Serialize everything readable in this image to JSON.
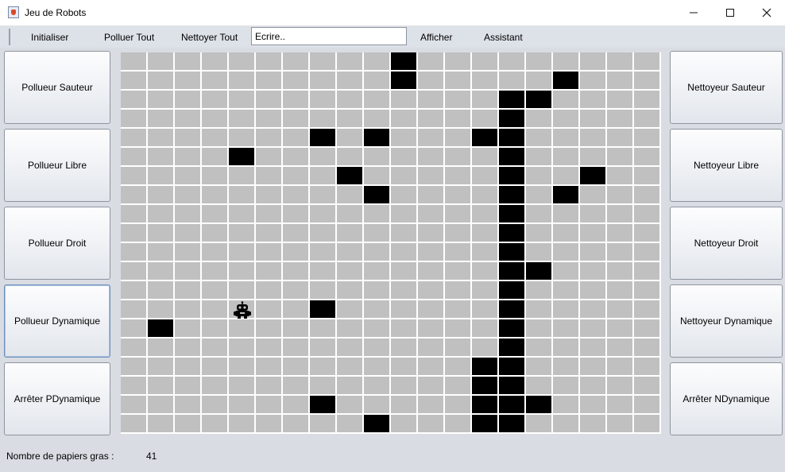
{
  "window": {
    "title": "Jeu de Robots",
    "icon": "java-app-icon",
    "controls": [
      "minimize-icon",
      "maximize-icon",
      "close-icon"
    ]
  },
  "menu": {
    "initialiser": "Initialiser",
    "polluer_tout": "Polluer Tout",
    "nettoyer_tout": "Nettoyer Tout",
    "input_value": "Ecrire..",
    "afficher": "Afficher",
    "assistant": "Assistant"
  },
  "left_buttons": [
    "Pollueur Sauteur",
    "Pollueur Libre",
    "Pollueur Droit",
    "Pollueur Dynamique",
    "Arrêter PDynamique"
  ],
  "right_buttons": [
    "Nettoyeur Sauteur",
    "Nettoyeur Libre",
    "Nettoyeur Droit",
    "Nettoyeur Dynamique",
    "Arrêter NDynamique"
  ],
  "grid": {
    "columns": 20,
    "rows": 20,
    "cell_color": "#c0c0c0",
    "paper_color": "#000000",
    "line_color": "#ffffff",
    "dirty_cells": [
      [
        0,
        10
      ],
      [
        1,
        10
      ],
      [
        1,
        16
      ],
      [
        2,
        14
      ],
      [
        2,
        15
      ],
      [
        3,
        14
      ],
      [
        4,
        7
      ],
      [
        4,
        9
      ],
      [
        4,
        13
      ],
      [
        4,
        14
      ],
      [
        5,
        4
      ],
      [
        5,
        14
      ],
      [
        6,
        8
      ],
      [
        6,
        14
      ],
      [
        6,
        17
      ],
      [
        7,
        9
      ],
      [
        7,
        14
      ],
      [
        7,
        16
      ],
      [
        8,
        14
      ],
      [
        9,
        14
      ],
      [
        10,
        14
      ],
      [
        11,
        14
      ],
      [
        11,
        15
      ],
      [
        12,
        14
      ],
      [
        13,
        7
      ],
      [
        13,
        14
      ],
      [
        14,
        1
      ],
      [
        14,
        14
      ],
      [
        15,
        14
      ],
      [
        16,
        13
      ],
      [
        16,
        14
      ],
      [
        17,
        13
      ],
      [
        17,
        14
      ],
      [
        18,
        7
      ],
      [
        18,
        13
      ],
      [
        18,
        14
      ],
      [
        18,
        15
      ],
      [
        19,
        9
      ],
      [
        19,
        13
      ],
      [
        19,
        14
      ]
    ],
    "robot": {
      "row": 13,
      "col": 4,
      "icon": "robot-icon"
    }
  },
  "status": {
    "label": "Nombre de papiers gras :",
    "value": "41"
  }
}
